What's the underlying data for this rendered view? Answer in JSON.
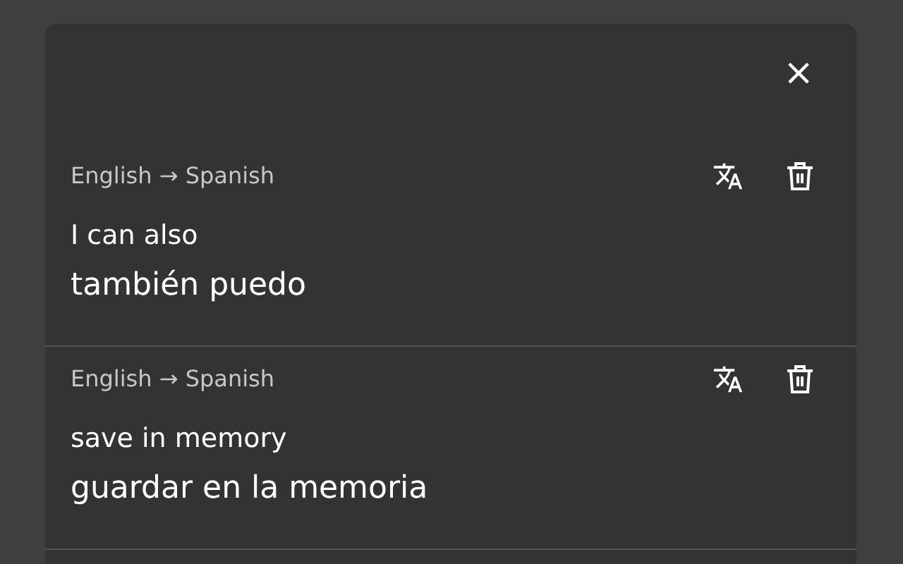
{
  "dialog": {
    "close_label": "×"
  },
  "entries": [
    {
      "languages": "English → Spanish",
      "source": "I can also",
      "translation": "también puedo"
    },
    {
      "languages": "English → Spanish",
      "source": "save in memory",
      "translation": "guardar en la memoria"
    }
  ]
}
